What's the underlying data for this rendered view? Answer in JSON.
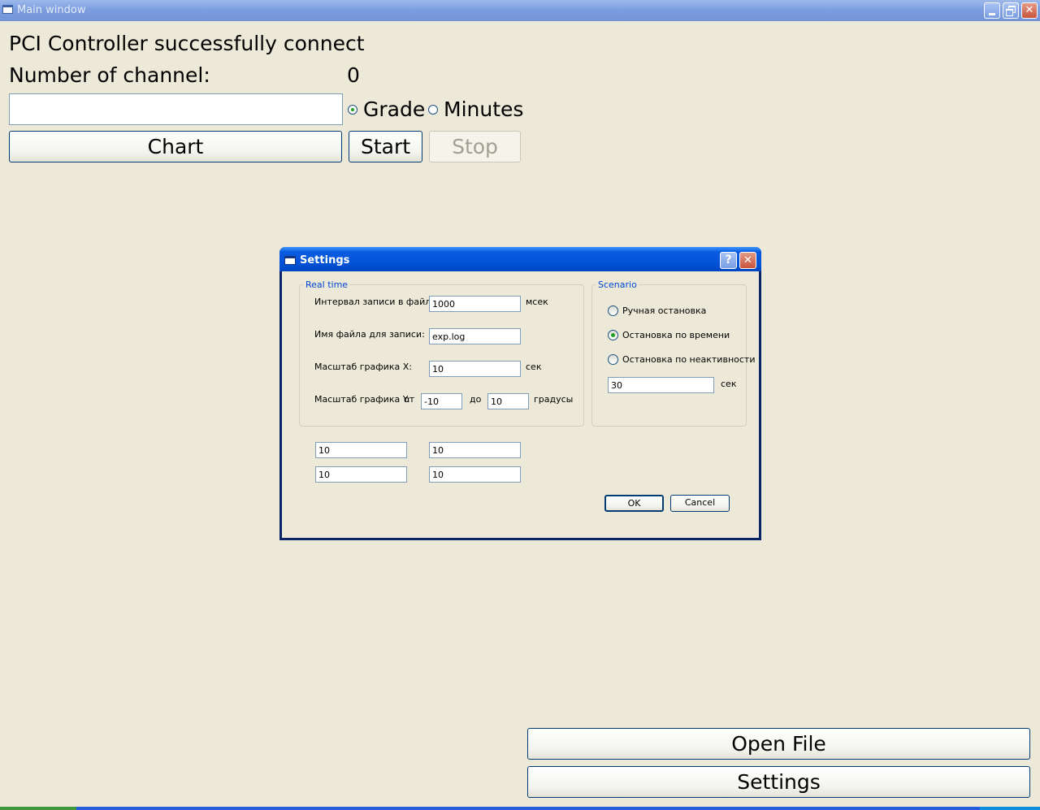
{
  "main_window": {
    "title": "Main window",
    "status_text": "PCI Controller successfully connect",
    "channel_label": "Number of channel:",
    "channel_value": "0",
    "input_value": "",
    "radio_grade_label": "Grade",
    "radio_minutes_label": "Minutes",
    "radio_selected": "Grade",
    "chart_button": "Chart",
    "start_button": "Start",
    "stop_button": "Stop",
    "open_file_button": "Open File",
    "settings_button": "Settings"
  },
  "settings_dialog": {
    "title": "Settings",
    "help_glyph": "?",
    "close_glyph": "✕",
    "realtime_group": {
      "title": "Real time",
      "interval_label": "Интервал записи в файл:",
      "interval_value": "1000",
      "interval_unit": "мсек",
      "filename_label": "Имя файла для записи:",
      "filename_value": "exp.log",
      "scale_x_label": "Масштаб графика X:",
      "scale_x_value": "10",
      "scale_x_unit": "сек",
      "scale_y_label": "Масштаб графика Y:",
      "from_label": "от",
      "scale_y_from": "-10",
      "to_label": "до",
      "scale_y_to": "10",
      "scale_y_unit": "градусы"
    },
    "scenario_group": {
      "title": "Scenario",
      "option_manual": "Ручная остановка",
      "option_time": "Остановка по времени",
      "option_inactive": "Остановка по неактивности",
      "selected_option": "Остановка по времени",
      "time_value": "30",
      "time_unit": "сек"
    },
    "extra_fields": [
      "10",
      "10",
      "10",
      "10"
    ],
    "ok_button": "OK",
    "cancel_button": "Cancel"
  },
  "colors": {
    "window_background": "#ECE9D8",
    "dialog_title_blue": "#0052D6",
    "group_title_blue": "#0046D5",
    "radio_dot_green": "#21A121",
    "button_border": "#003C74"
  },
  "icons": {
    "window_icon": "app-window-icon",
    "minimize": "minimize-icon",
    "maximize": "restore-icon",
    "close": "close-icon",
    "help": "help-icon"
  }
}
